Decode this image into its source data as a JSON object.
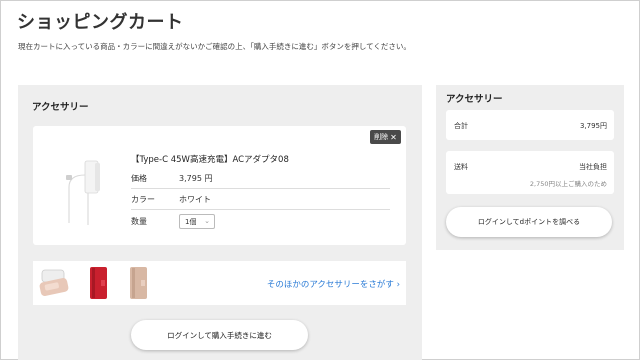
{
  "page": {
    "title": "ショッピングカート",
    "notice": "現在カートに入っている商品・カラーに間違えがないかご確認の上、「購入手続きに進む」ボタンを押してください。"
  },
  "cart": {
    "section_title": "アクセサリー",
    "item": {
      "delete_label": "削除",
      "name": "【Type-C 45W高速充電】ACアダプタ08",
      "price_label": "価格",
      "price_value": "3,795 円",
      "color_label": "カラー",
      "color_value": "ホワイト",
      "qty_label": "数量",
      "qty_value": "1個"
    },
    "accessory_link": "そのほかのアクセサリーをさがす ›",
    "login_checkout_button": "ログインして購入手続きに進む"
  },
  "summary": {
    "section_title": "アクセサリー",
    "subtotal_label": "合計",
    "subtotal_value": "3,795円",
    "shipping_label": "送料",
    "shipping_value": "当社負担",
    "shipping_note": "2,750円以上ご購入のため",
    "login_points_button": "ログインしてdポイントを調べる"
  },
  "colors": {
    "panel_bg": "#eeeeee",
    "link": "#2a7bd6",
    "delete_bg": "#4a4a4a"
  }
}
